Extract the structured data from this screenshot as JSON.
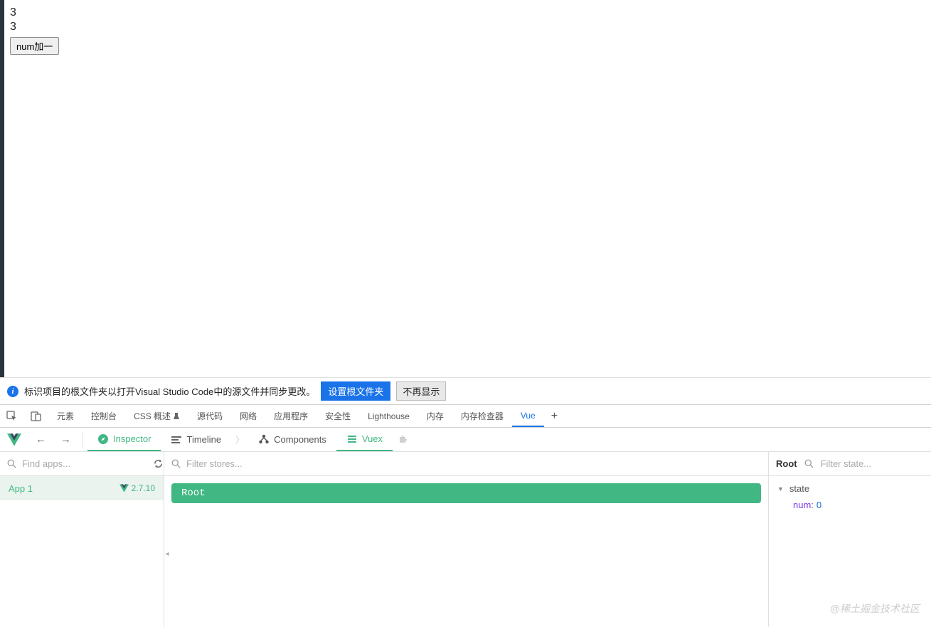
{
  "page": {
    "line1": "3",
    "line2": "3",
    "button_label": "num加一"
  },
  "info_bar": {
    "message": "标识项目的根文件夹以打开Visual Studio Code中的源文件并同步更改。",
    "set_root_label": "设置根文件夹",
    "dismiss_label": "不再显示"
  },
  "devtools_tabs": {
    "items": [
      "元素",
      "控制台",
      "CSS 概述",
      "源代码",
      "网络",
      "应用程序",
      "安全性",
      "Lighthouse",
      "内存",
      "内存检查器",
      "Vue"
    ],
    "active_index": 10
  },
  "vue_bar": {
    "inspector": "Inspector",
    "timeline": "Timeline",
    "components": "Components",
    "vuex": "Vuex"
  },
  "panels": {
    "left": {
      "find_apps_placeholder": "Find apps...",
      "app_name": "App 1",
      "vue_version": "2.7.10"
    },
    "mid": {
      "filter_stores_placeholder": "Filter stores...",
      "root_label": "Root"
    },
    "right": {
      "title": "Root",
      "filter_state_placeholder": "Filter state...",
      "state_label": "state",
      "state": {
        "key": "num",
        "value": "0"
      }
    }
  },
  "watermark": "@稀土掘金技术社区"
}
